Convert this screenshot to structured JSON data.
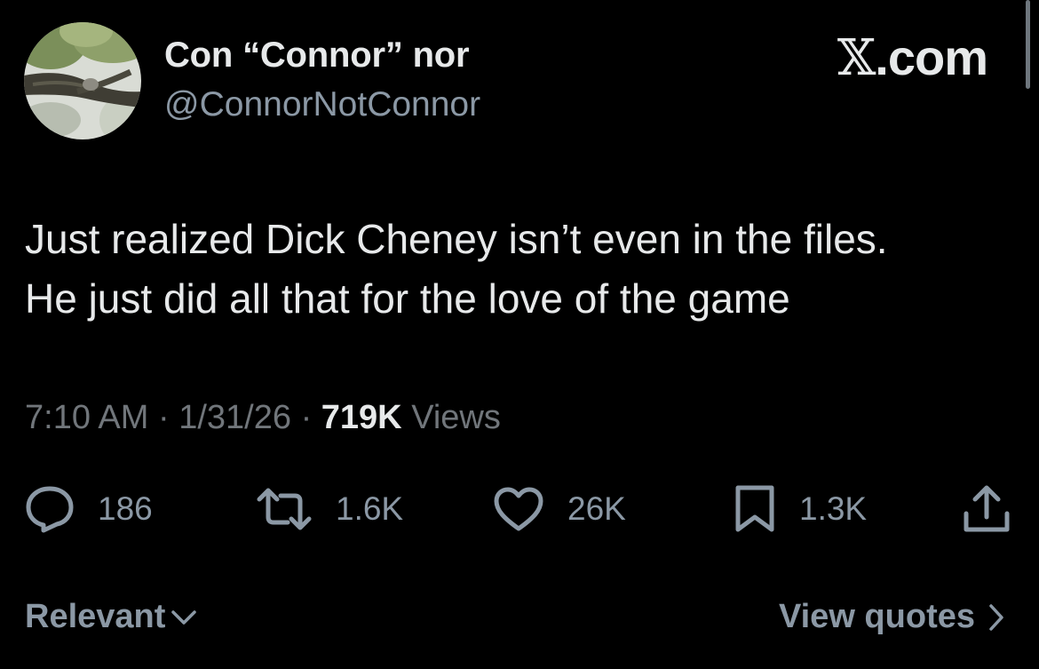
{
  "author": {
    "display_name": "Con “Connor” nor",
    "handle": "@ConnorNotConnor"
  },
  "site": {
    "label": "X.com",
    "x_glyph": "𝕏",
    "suffix": ".com"
  },
  "tweet": {
    "text_lines": [
      "Just realized Dick Cheney isn’t even in the files.",
      "He just did all that for the love of the game"
    ],
    "time": "7:10 AM",
    "date": "1/31/26",
    "separator": "·",
    "views_count": "719K",
    "views_label": "Views"
  },
  "actions": {
    "reply": {
      "icon": "reply-icon",
      "count": "186"
    },
    "repost": {
      "icon": "repost-icon",
      "count": "1.6K"
    },
    "like": {
      "icon": "heart-icon",
      "count": "26K"
    },
    "bookmark": {
      "icon": "bookmark-icon",
      "count": "1.3K"
    },
    "share": {
      "icon": "share-icon"
    }
  },
  "footer": {
    "sort_label": "Relevant",
    "view_quotes_label": "View quotes"
  },
  "colors": {
    "background": "#000000",
    "primary_text": "#e7e9ea",
    "secondary_text": "#71767b",
    "icon_gray": "#8b98a5"
  }
}
